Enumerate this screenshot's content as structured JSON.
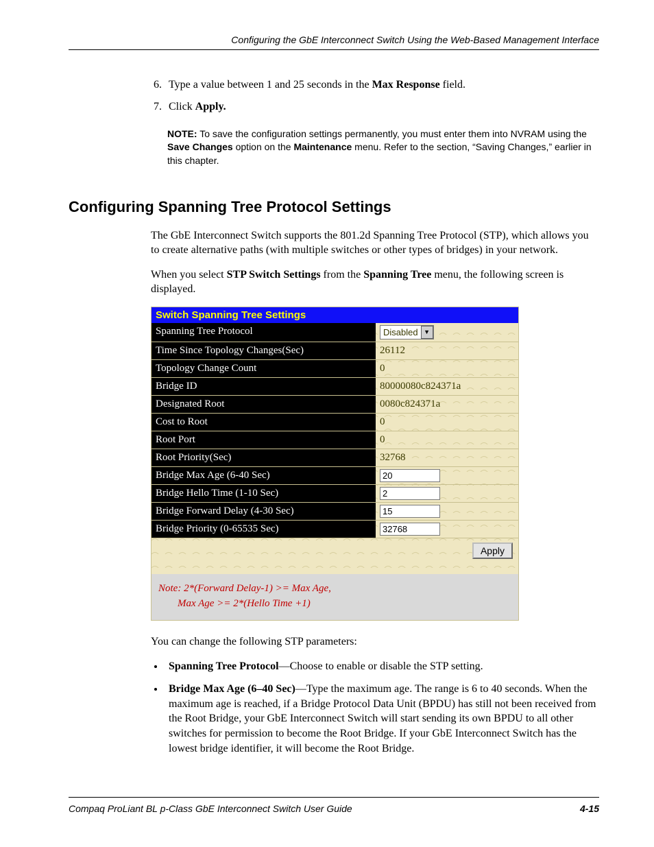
{
  "header": {
    "running_title": "Configuring the GbE Interconnect Switch Using the Web-Based Management Interface"
  },
  "steps": {
    "start": "6",
    "s6_pre": "Type a value between 1 and 25 seconds in the ",
    "s6_bold": "Max Response",
    "s6_post": " field.",
    "s7_pre": "Click ",
    "s7_bold": "Apply."
  },
  "note": {
    "label": "NOTE:",
    "t1a": "  To save the configuration settings permanently, you must enter them into NVRAM using the ",
    "t1b": "Save Changes",
    "t1c": " option on the ",
    "t1d": "Maintenance",
    "t1e": " menu. Refer to the section, “Saving Changes,” earlier in this chapter."
  },
  "section": {
    "heading": "Configuring Spanning Tree Protocol Settings",
    "p1": "The GbE Interconnect Switch supports the 801.2d Spanning Tree Protocol (STP), which allows you to create alternative paths (with multiple switches or other types of bridges) in your network.",
    "p2_pre": "When you select ",
    "p2_b1": "STP Switch Settings",
    "p2_mid": " from the ",
    "p2_b2": "Spanning Tree",
    "p2_post": " menu, the following screen is displayed."
  },
  "screenshot": {
    "title": "Switch Spanning Tree Settings",
    "rows": [
      {
        "label": "Spanning Tree Protocol",
        "type": "select",
        "value": "Disabled"
      },
      {
        "label": "Time Since Topology Changes(Sec)",
        "type": "text",
        "value": "26112"
      },
      {
        "label": "Topology Change Count",
        "type": "text",
        "value": "0"
      },
      {
        "label": "Bridge ID",
        "type": "text",
        "value": "80000080c824371a"
      },
      {
        "label": "Designated Root",
        "type": "text",
        "value": "0080c824371a"
      },
      {
        "label": "Cost to Root",
        "type": "text",
        "value": "0"
      },
      {
        "label": "Root Port",
        "type": "text",
        "value": "0"
      },
      {
        "label": "Root Priority(Sec)",
        "type": "text",
        "value": "32768"
      },
      {
        "label": "Bridge Max Age (6-40 Sec)",
        "type": "input",
        "value": "20"
      },
      {
        "label": "Bridge Hello Time (1-10 Sec)",
        "type": "input",
        "value": "2"
      },
      {
        "label": "Bridge Forward Delay (4-30 Sec)",
        "type": "input",
        "value": "15"
      },
      {
        "label": "Bridge Priority (0-65535 Sec)",
        "type": "input",
        "value": "32768"
      }
    ],
    "apply_label": "Apply",
    "footnote1": "Note: 2*(Forward Delay-1) >= Max Age,",
    "footnote2": "Max Age >= 2*(Hello Time +1)"
  },
  "after": {
    "lead": "You can change the following STP parameters:",
    "b1_bold": "Spanning Tree Protocol",
    "b1_rest": "—Choose to enable or disable the STP setting.",
    "b2_bold": "Bridge Max Age (6–40 Sec)",
    "b2_rest": "—Type the maximum age. The range is 6 to 40 seconds. When the maximum age is reached, if a Bridge Protocol Data Unit (BPDU) has still not been received from the Root Bridge, your GbE Interconnect Switch will start sending its own BPDU to all other switches for permission to become the Root Bridge. If your GbE Interconnect Switch has the lowest bridge identifier, it will become the Root Bridge."
  },
  "footer": {
    "doc_title": "Compaq ProLiant BL p-Class GbE Interconnect Switch User Guide",
    "page": "4-15"
  }
}
